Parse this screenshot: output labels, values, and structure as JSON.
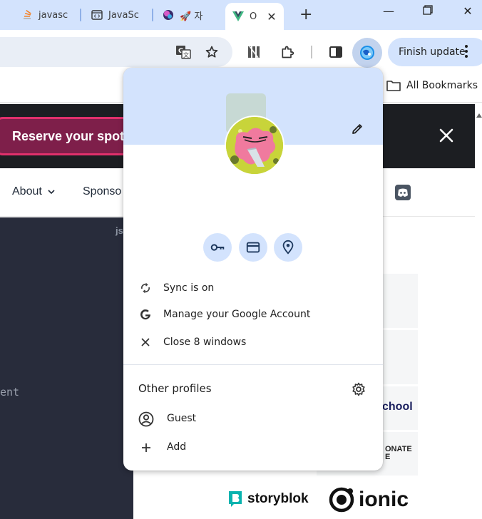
{
  "tabs": [
    {
      "label": "javasc",
      "icon": "stackoverflow-icon"
    },
    {
      "label": "JavaSc",
      "icon": "code-page-icon"
    },
    {
      "label": "🚀 자",
      "icon": "colorful-orb-icon"
    },
    {
      "label": "O",
      "icon": "vue-logo-icon",
      "active": true
    }
  ],
  "toolbar": {
    "finish_update": "Finish update"
  },
  "bookmarks": {
    "all_bookmarks": "All Bookmarks"
  },
  "page": {
    "reserve": "Reserve your spot",
    "nav_about": "About",
    "nav_sponsor": "Sponso",
    "js_label": "js",
    "dark_text": "ent",
    "school": "chool",
    "donate_line1": "ONATE",
    "donate_line2": "E",
    "storyblok": "storyblok",
    "ionic": "ionic"
  },
  "profile_menu": {
    "quick_actions": [
      "passwords-key-icon",
      "payment-card-icon",
      "addresses-location-icon"
    ],
    "sync": "Sync is on",
    "manage_account": "Manage your Google Account",
    "close_windows": "Close 8 windows",
    "other_profiles": "Other profiles",
    "guest": "Guest",
    "add": "Add"
  },
  "colors": {
    "tabstrip": "#d3e3fd",
    "accent_blue": "#0b57d0",
    "banner_pink": "#e0306c",
    "dark_panel": "#282c3b"
  }
}
